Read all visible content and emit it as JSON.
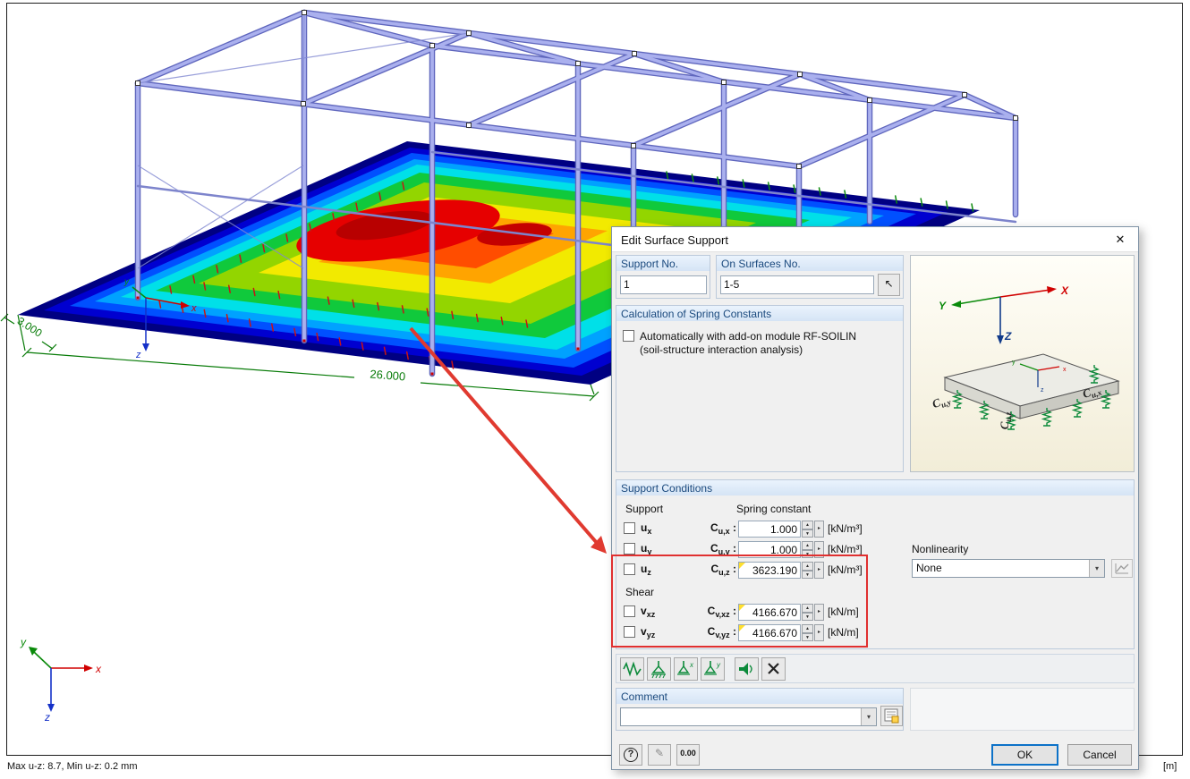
{
  "scene": {
    "dim_3": "3.000",
    "dim_26": "26.000",
    "axis": {
      "x": "x",
      "y": "y",
      "z": "z"
    },
    "status_left": "Max u-z: 8.7, Min u-z: 0.2 mm",
    "status_right": "[m]"
  },
  "icons": {
    "up": "▲",
    "down": "▼",
    "dropdown": "▾",
    "more": "▸",
    "picker": "↖",
    "close": "✕",
    "help": "?",
    "edit": "✎"
  },
  "dialog": {
    "title": "Edit Surface Support",
    "support_no": {
      "label": "Support No.",
      "value": "1"
    },
    "on_surfaces": {
      "label": "On Surfaces No.",
      "value": "1-5"
    },
    "calc": {
      "label": "Calculation of Spring Constants",
      "line1": "Automatically with add-on module RF-SOILIN",
      "line2": "(soil-structure interaction analysis)"
    },
    "diagram": {
      "x": "X",
      "y": "Y",
      "z": "Z",
      "labels": [
        {
          "base": "C",
          "sub": "u,y"
        },
        {
          "base": "C",
          "sub": "u,z"
        },
        {
          "base": "C",
          "sub": "u,x"
        }
      ]
    },
    "conditions": {
      "label": "Support Conditions",
      "support_header": "Support",
      "spring_header": "Spring constant",
      "shear_label": "Shear",
      "nonlinearity_label": "Nonlinearity",
      "nonlinearity_value": "None",
      "rows": [
        {
          "base": "u",
          "sub": "x",
          "cbase": "C",
          "csub": "u,x",
          "colon": ":",
          "value": "1.000",
          "unit": "[kN/m³]",
          "modified": false
        },
        {
          "base": "u",
          "sub": "y",
          "cbase": "C",
          "csub": "u,y",
          "colon": ":",
          "value": "1.000",
          "unit": "[kN/m³]",
          "modified": false
        },
        {
          "base": "u",
          "sub": "z",
          "cbase": "C",
          "csub": "u,z",
          "colon": ":",
          "value": "3623.190",
          "unit": "[kN/m³]",
          "modified": true
        },
        {
          "base": "v",
          "sub": "xz",
          "cbase": "C",
          "csub": "v,xz",
          "colon": ":",
          "value": "4166.670",
          "unit": "[kN/m]",
          "modified": true
        },
        {
          "base": "v",
          "sub": "yz",
          "cbase": "C",
          "csub": "v,yz",
          "colon": ":",
          "value": "4166.670",
          "unit": "[kN/m]",
          "modified": true
        }
      ]
    },
    "comment": {
      "label": "Comment",
      "value": ""
    },
    "buttons": {
      "ok": "OK",
      "cancel": "Cancel",
      "units": "0.00"
    }
  }
}
